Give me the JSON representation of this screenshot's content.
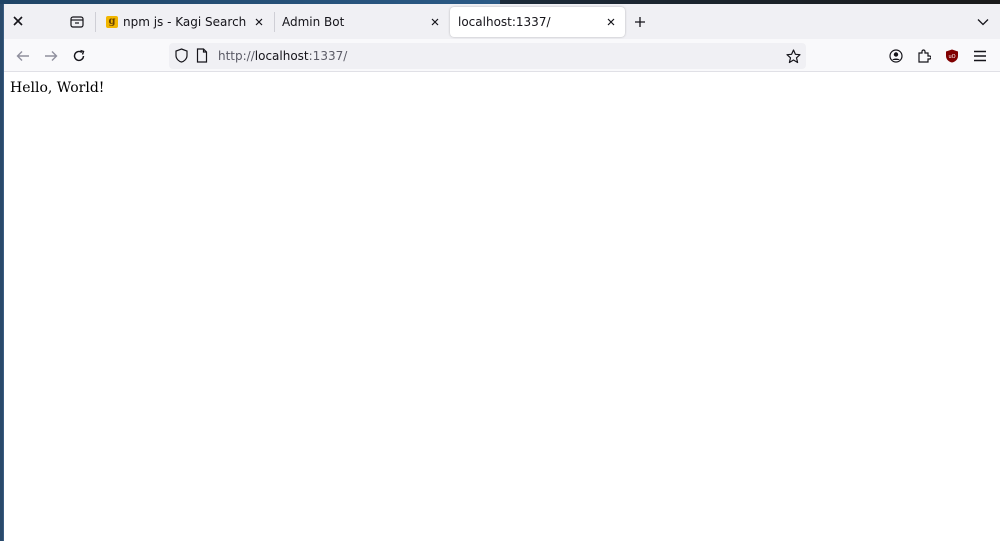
{
  "browser": {
    "tabs": [
      {
        "label": "npm js - Kagi Search",
        "favicon": "g",
        "active": false
      },
      {
        "label": "Admin Bot",
        "active": false
      },
      {
        "label": "localhost:1337/",
        "active": true
      }
    ],
    "url": {
      "scheme": "http://",
      "host": "localhost",
      "rest": ":1337/"
    },
    "icons": [
      "close-icon",
      "tab-list-icon",
      "new-tab-icon",
      "list-all-tabs-icon",
      "back-icon",
      "forward-icon",
      "reload-icon",
      "shield-icon",
      "page-icon",
      "bookmark-star-icon",
      "account-icon",
      "extensions-icon",
      "ublock-icon",
      "menu-icon"
    ],
    "accent": "#c40000"
  },
  "page": {
    "body_text": "Hello, World!"
  }
}
